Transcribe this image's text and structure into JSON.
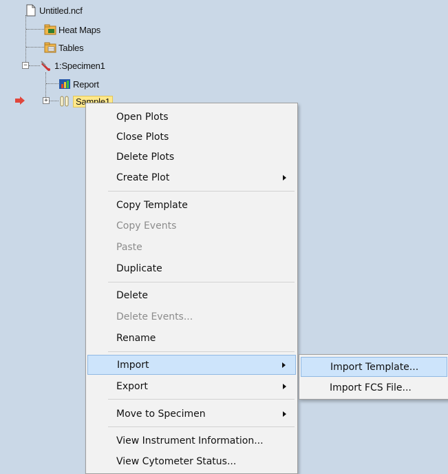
{
  "tree": {
    "items": [
      {
        "label": "Untitled.ncf",
        "icon": "document-icon"
      },
      {
        "label": "Heat Maps",
        "icon": "heat-maps-folder-icon"
      },
      {
        "label": "Tables",
        "icon": "tables-folder-icon"
      },
      {
        "label": "1:Specimen1",
        "icon": "specimen-icon"
      },
      {
        "label": "Report",
        "icon": "report-chart-icon"
      },
      {
        "label": "Sample1",
        "icon": "sample-tubes-icon"
      }
    ],
    "expander_collapse": "−",
    "expander_expand": "+"
  },
  "context_menu": {
    "items": [
      {
        "label": "Open Plots",
        "enabled": true
      },
      {
        "label": "Close Plots",
        "enabled": true
      },
      {
        "label": "Delete Plots",
        "enabled": true
      },
      {
        "label": "Create Plot",
        "enabled": true,
        "submenu": true
      },
      {
        "label": "Copy Template",
        "enabled": true
      },
      {
        "label": "Copy Events",
        "enabled": false
      },
      {
        "label": "Paste",
        "enabled": false
      },
      {
        "label": "Duplicate",
        "enabled": true
      },
      {
        "label": "Delete",
        "enabled": true
      },
      {
        "label": "Delete Events...",
        "enabled": false
      },
      {
        "label": "Rename",
        "enabled": true
      },
      {
        "label": "Import",
        "enabled": true,
        "submenu": true,
        "highlighted": true
      },
      {
        "label": "Export",
        "enabled": true,
        "submenu": true
      },
      {
        "label": "Move to Specimen",
        "enabled": true,
        "submenu": true
      },
      {
        "label": "View Instrument Information...",
        "enabled": true
      },
      {
        "label": "View Cytometer Status...",
        "enabled": true
      }
    ]
  },
  "import_submenu": {
    "items": [
      {
        "label": "Import Template...",
        "highlighted": true
      },
      {
        "label": "Import FCS File..."
      }
    ]
  },
  "colors": {
    "background": "#cad8e7",
    "menu_background": "#f2f2f2",
    "highlight": "#cde4fb",
    "selection": "#ffe88a",
    "current_arrow": "#e0463c"
  }
}
